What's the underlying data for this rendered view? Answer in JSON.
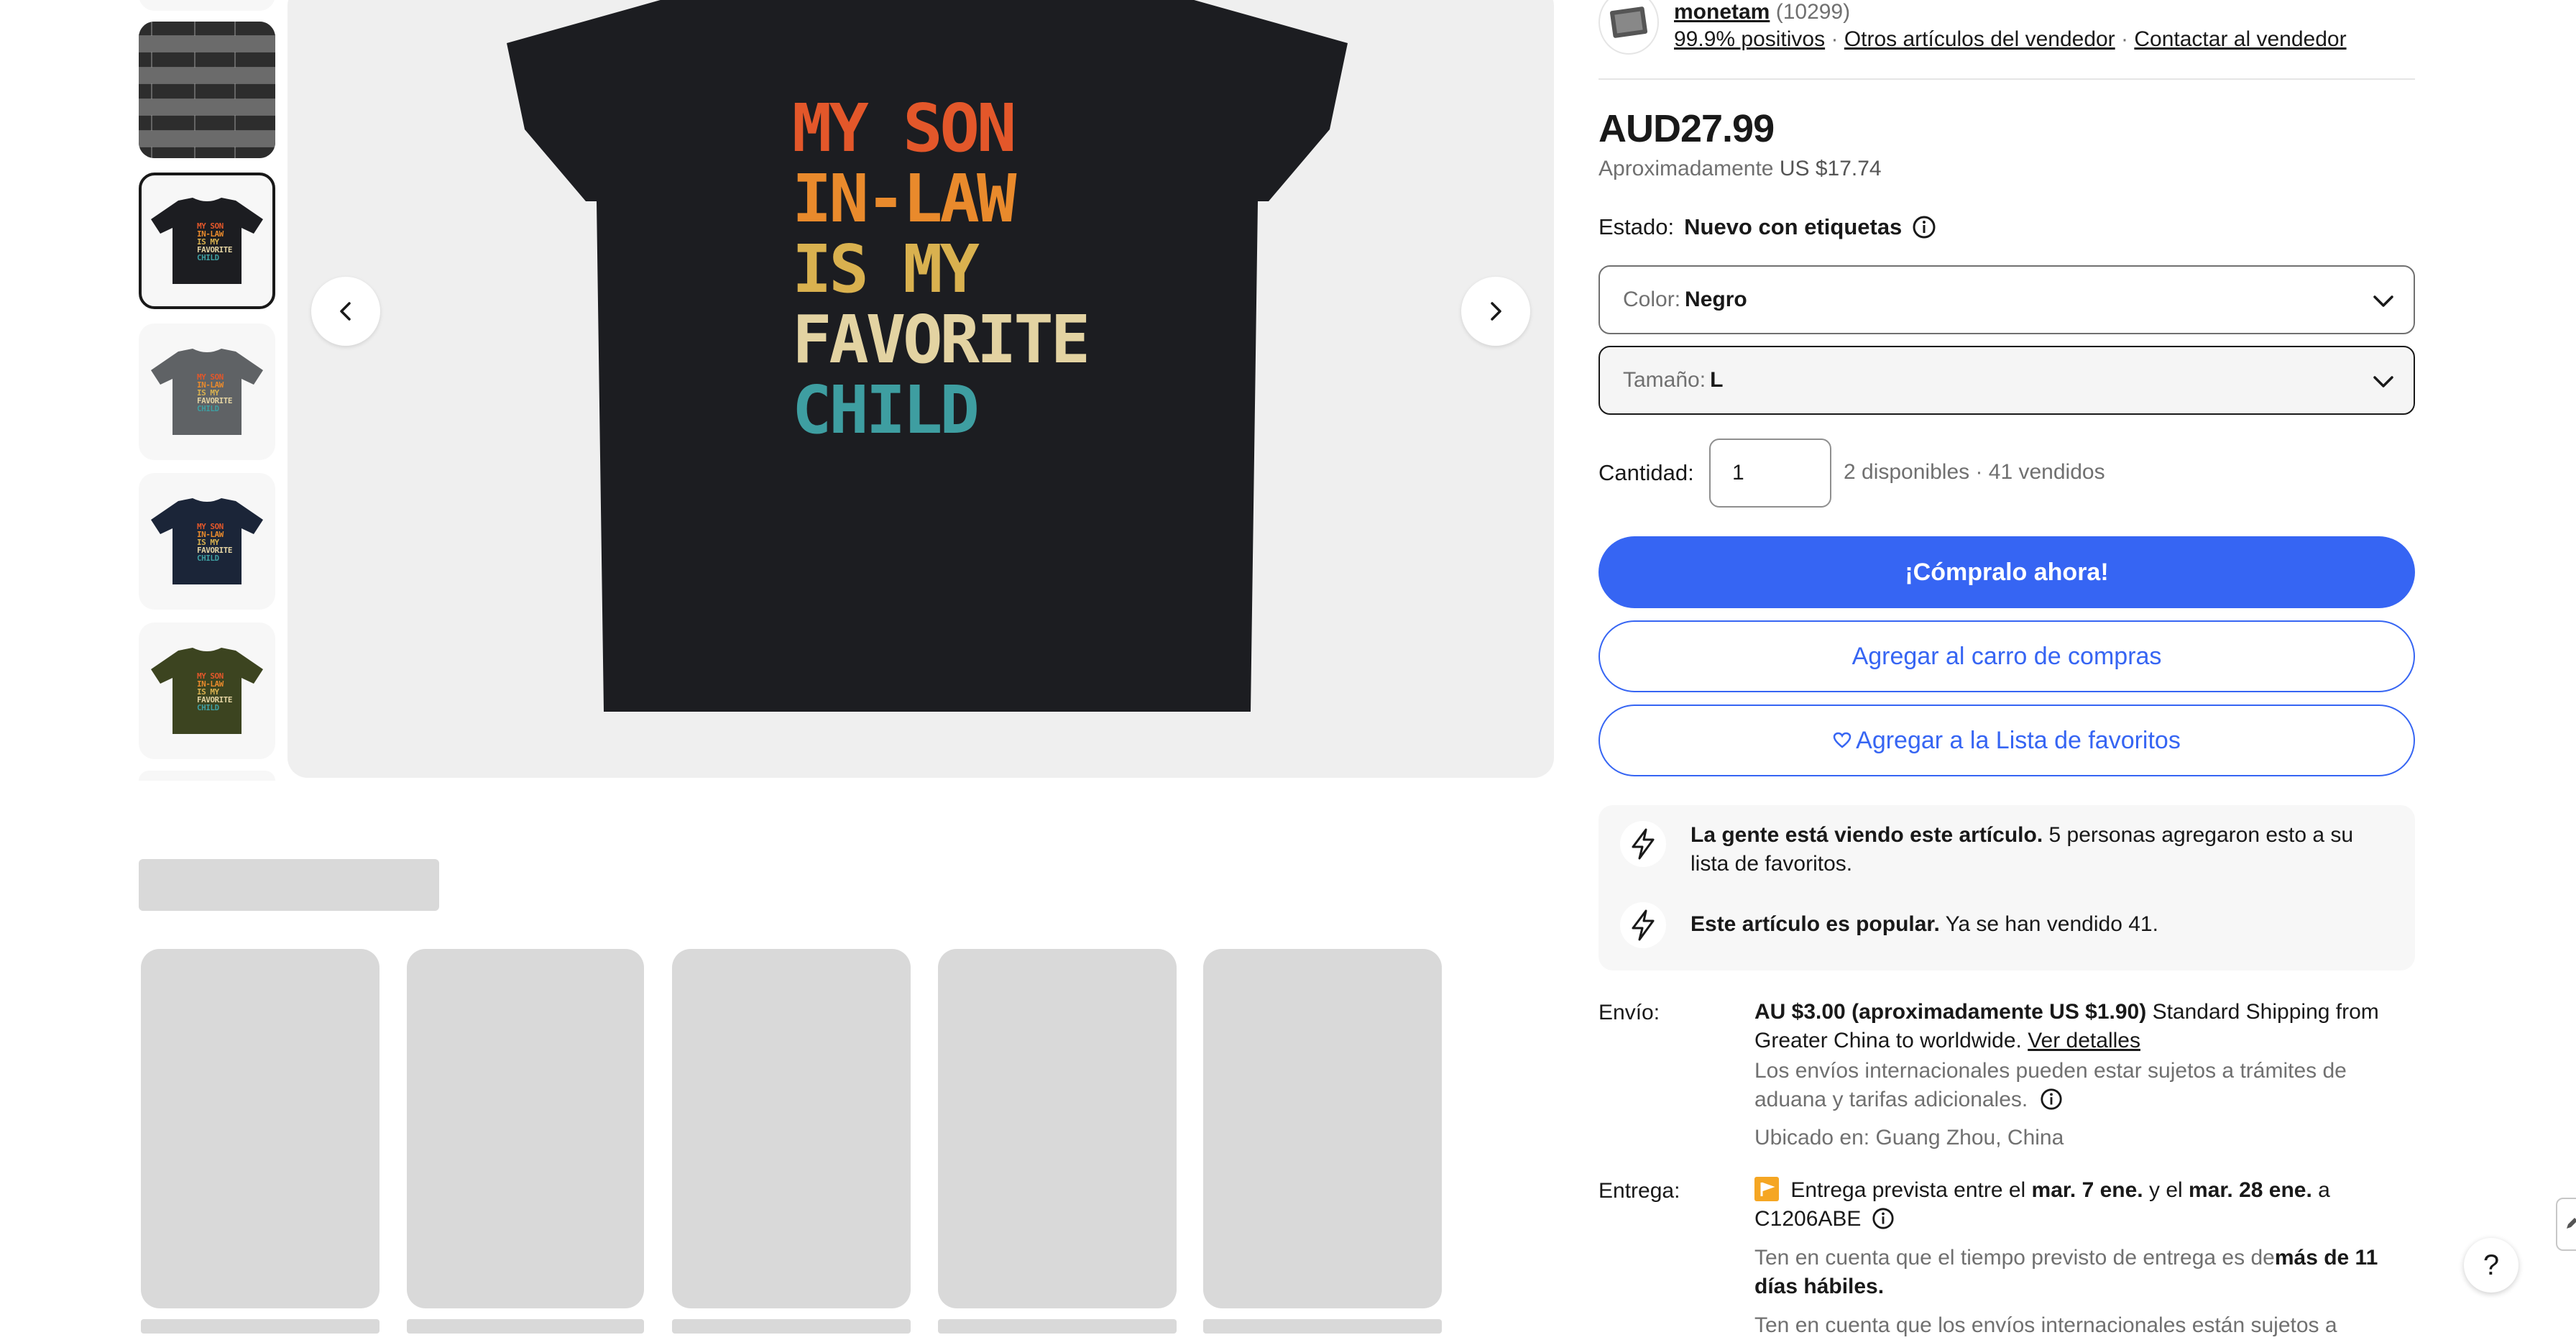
{
  "seller": {
    "name": "monetam",
    "count": "(10299)",
    "positive": "99.9% positivos",
    "other_items": "Otros artículos del vendedor",
    "contact": "Contactar al vendedor",
    "sep": "·"
  },
  "price": {
    "main": "AUD27.99",
    "approx_label": "Aproximadamente",
    "approx_value": "US $17.74"
  },
  "condition": {
    "label": "Estado:",
    "value": "Nuevo con etiquetas"
  },
  "color_select": {
    "label": "Color:",
    "value": "Negro"
  },
  "size_select": {
    "label": "Tamaño:",
    "value": "L"
  },
  "quantity": {
    "label": "Cantidad:",
    "value": "1",
    "availability": "2 disponibles · 41 vendidos"
  },
  "buttons": {
    "buy_now": "¡Cómpralo ahora!",
    "add_to_cart": "Agregar al carro de compras",
    "watchlist": "Agregar a la Lista de favoritos"
  },
  "signals": [
    {
      "bold": "La gente está viendo este artículo.",
      "text": "5 personas agregaron esto a su lista de favoritos."
    },
    {
      "bold": "Este artículo es popular.",
      "text": "Ya se han vendido 41."
    }
  ],
  "shipping": {
    "label": "Envío:",
    "price_bold": "AU $3.00 (aproximadamente US $1.90)",
    "service": "Standard Shipping from Greater China to worldwide.",
    "details_link": "Ver detalles",
    "intl_note": "Los envíos internacionales pueden estar sujetos a trámites de aduana y tarifas adicionales.",
    "location": "Ubicado en: Guang Zhou, China"
  },
  "delivery": {
    "label": "Entrega:",
    "pre": "Entrega prevista entre el",
    "date1": "mar. 7 ene.",
    "mid": "y el",
    "date2": "mar. 28 ene.",
    "post": "a C1206ABE",
    "note_pre": "Ten en cuenta que el tiempo previsto de entrega es de",
    "note_bold": "más de 11 días hábiles.",
    "note2": "Ten en cuenta que los envíos internacionales están sujetos a"
  },
  "shirt_text": {
    "l1": "MY SON",
    "l2": "IN-LAW",
    "l3": "IS MY",
    "l4": "FAVORITE",
    "l5": "CHILD"
  },
  "help_label": "?",
  "colors": {
    "buy_blue": "#3665f3",
    "link_blue": "#3665f3",
    "shirt_black": "#1c1d21",
    "shirt_gray": "#5f6265",
    "shirt_navy": "#1b2538",
    "shirt_olive": "#3c4420",
    "orange1": "#e3572a",
    "orange2": "#e98a2c",
    "yellow": "#d9b14f",
    "cream": "#e3d3a2",
    "teal": "#3e9ea1",
    "delivery_flag": "#f5a623"
  },
  "icons": [
    "chevron-left-icon",
    "chevron-right-icon",
    "chevron-down-icon",
    "info-icon",
    "heart-icon",
    "lightning-icon",
    "help-icon",
    "store-avatar-icon",
    "flag-icon"
  ]
}
